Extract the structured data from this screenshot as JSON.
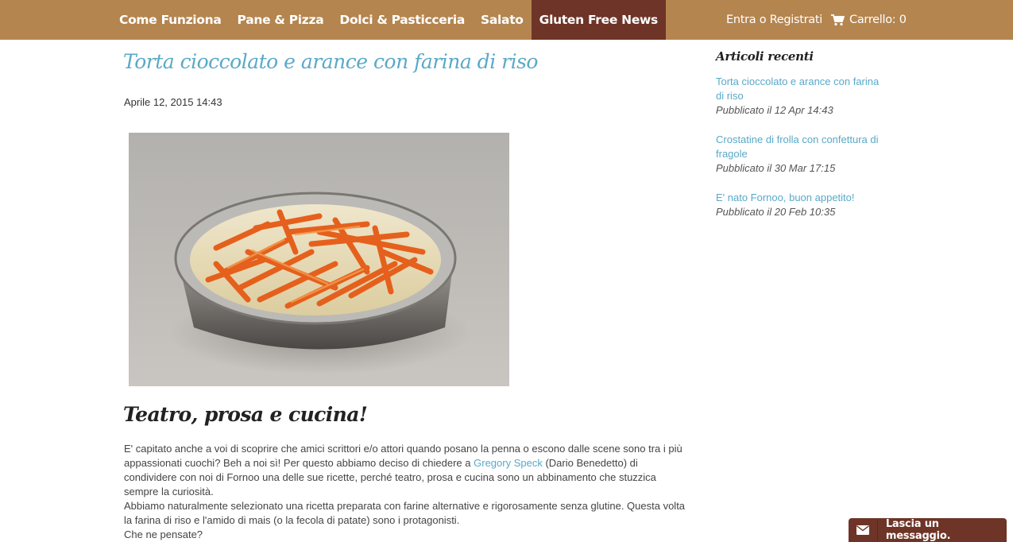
{
  "nav": {
    "items": [
      {
        "label": "Come Funziona"
      },
      {
        "label": "Pane & Pizza"
      },
      {
        "label": "Dolci & Pasticceria"
      },
      {
        "label": "Salato"
      },
      {
        "label": "Gluten Free News",
        "active": true
      }
    ],
    "account_label": "Entra o Registrati",
    "cart_label": "Carrello: 0",
    "cart_icon": "cart-icon"
  },
  "article": {
    "title": "Torta cioccolato e arance con farina di riso",
    "date": "Aprile 12, 2015 14:43",
    "heading": "Teatro, prosa e cucina!",
    "p1_before_link": "E' capitato anche a voi di scoprire che amici scrittori e/o attori quando posano la penna o escono dalle scene sono tra i più appassionati cuochi? Beh a noi sì! Per questo abbiamo deciso di chiedere a ",
    "p1_link": "Gregory Speck",
    "p1_after_link": " (Dario Benedetto) di condividere con noi di Fornoo una delle sue ricette, perché teatro, prosa e cucina sono un abbinamento che stuzzica sempre la curiosità.",
    "p2": "Abbiamo naturalmente selezionato una ricetta preparata con farine alternative e rigorosamente senza glutine. Questa volta la farina di riso e l'amido di mais (o la fecola di patate) sono i protagonisti.",
    "p3": "Che ne pensate?"
  },
  "sidebar": {
    "heading": "Articoli recenti",
    "items": [
      {
        "title": "Torta cioccolato e arance con farina di riso",
        "meta": "Pubblicato il 12 Apr 14:43"
      },
      {
        "title": "Crostatine di frolla con confettura di fragole",
        "meta": "Pubblicato il 30 Mar 17:15"
      },
      {
        "title": "E' nato Fornoo, buon appetito!",
        "meta": "Pubblicato il 20 Feb 10:35"
      }
    ]
  },
  "widget": {
    "label": "Lascia un messaggio.",
    "icon": "envelope-icon"
  },
  "colors": {
    "nav_bg": "#b5854f",
    "nav_active": "#6e3427",
    "link": "#5aa9c7",
    "widget_bg": "#6e3427"
  }
}
